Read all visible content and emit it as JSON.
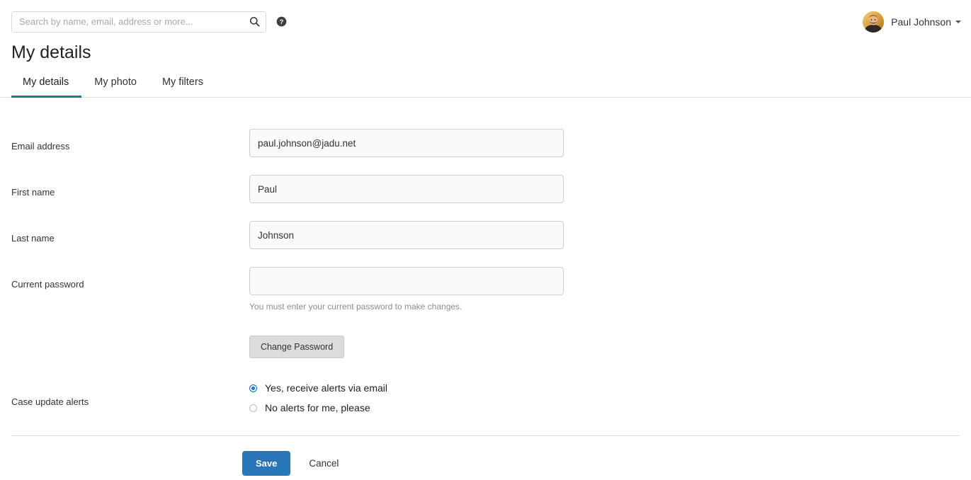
{
  "topbar": {
    "search": {
      "placeholder": "Search by name, email, address or more...",
      "value": "",
      "icon": "search-icon"
    },
    "help_icon": "help-circle-icon",
    "user": {
      "name": "Paul Johnson",
      "avatar_alt": "Paul Johnson avatar",
      "caret": "chevron-down-icon"
    }
  },
  "page": {
    "title": "My details"
  },
  "tabs": [
    {
      "label": "My details",
      "active": true
    },
    {
      "label": "My photo",
      "active": false
    },
    {
      "label": "My filters",
      "active": false
    }
  ],
  "form": {
    "email": {
      "label": "Email address",
      "value": "paul.johnson@jadu.net",
      "placeholder": ""
    },
    "first_name": {
      "label": "First name",
      "value": "Paul",
      "placeholder": ""
    },
    "last_name": {
      "label": "Last name",
      "value": "Johnson",
      "placeholder": ""
    },
    "current_password": {
      "label": "Current password",
      "value": "",
      "placeholder": "",
      "help": "You must enter your current password to make changes."
    },
    "change_password_button": "Change Password",
    "case_update_alerts": {
      "label": "Case update alerts",
      "options": [
        {
          "label": "Yes, receive alerts via email",
          "selected": true
        },
        {
          "label": "No alerts for me, please",
          "selected": false
        }
      ]
    }
  },
  "footer": {
    "save_label": "Save",
    "cancel_label": "Cancel"
  },
  "colors": {
    "tab_active_underline": "#1b7f85",
    "primary_button": "#2876b8",
    "radio_selected": "#1673d4",
    "input_background": "#fafafa",
    "input_border": "#cfcfcf"
  }
}
